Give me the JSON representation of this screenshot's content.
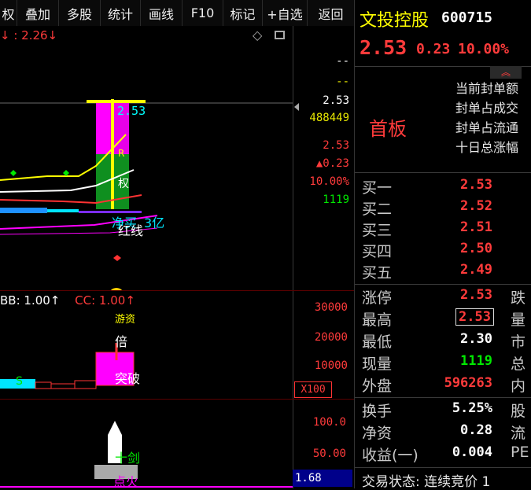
{
  "toolbar": {
    "items": [
      "权",
      "叠加",
      "多股",
      "统计",
      "画线",
      "F10",
      "标记",
      "+自选",
      "返回"
    ]
  },
  "chart": {
    "top_indicator": "↓ : 2.26↓",
    "price_line_label": "2.53",
    "axis": {
      "v1": "--",
      "v2": "--",
      "price": "2.53",
      "volume": "488449",
      "price2": "2.53",
      "change": "▲0.23",
      "pct": "10.00%",
      "vol2": "1119"
    },
    "annotations": {
      "seal": "3亿",
      "seal_prefix": "净买",
      "line_label": "红线",
      "quan": "权",
      "r_mark": "R"
    },
    "volume_panel": {
      "legend_bb": "BB: 1.00↑",
      "legend_cc": "CC: 1.00↑",
      "ticks": [
        "30000",
        "20000",
        "10000"
      ],
      "unit": "X100",
      "label_bei": "倍",
      "label_break": "突破",
      "label_top": "游资",
      "s_mark": "S"
    },
    "bottom_panel": {
      "ticks": [
        "100.0",
        "50.00"
      ],
      "current": "1.68",
      "label_sword": "十剑",
      "label_fire": "点火"
    }
  },
  "quote": {
    "name": "文投控股",
    "code": "600715",
    "price": "2.53",
    "change": "0.23",
    "pct": "10.00%",
    "board_label": "首板",
    "seal_info": [
      "当前封单额",
      "封单占成交",
      "封单占流通",
      "十日总涨幅"
    ],
    "bids": [
      {
        "label": "买一",
        "price": "2.53"
      },
      {
        "label": "买二",
        "price": "2.52"
      },
      {
        "label": "买三",
        "price": "2.51"
      },
      {
        "label": "买四",
        "price": "2.50"
      },
      {
        "label": "买五",
        "price": "2.49"
      }
    ],
    "stats": [
      {
        "label": "涨停",
        "value": "2.53",
        "right": "跌"
      },
      {
        "label": "最高",
        "value": "2.53",
        "right": "量"
      },
      {
        "label": "最低",
        "value": "2.30",
        "right": "市"
      },
      {
        "label": "现量",
        "value": "1119",
        "right": "总"
      },
      {
        "label": "外盘",
        "value": "596263",
        "right": "内"
      }
    ],
    "fundamentals": [
      {
        "label": "换手",
        "value": "5.25%",
        "right": "股"
      },
      {
        "label": "净资",
        "value": "0.28",
        "right": "流"
      },
      {
        "label": "收益(一)",
        "value": "0.004",
        "right": "PE"
      }
    ],
    "trade_status": "交易状态: 连续竞价 1"
  },
  "colors": {
    "up": "#ff3b3b",
    "down": "#00e800",
    "yellow": "#e8e800",
    "magenta": "#ff00ff",
    "cyan": "#00e5ff"
  }
}
